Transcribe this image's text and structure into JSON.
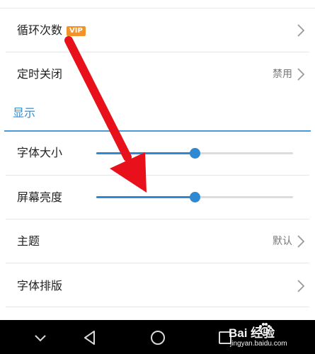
{
  "settings": {
    "loop_count": {
      "label": "循环次数",
      "badge": "VIP"
    },
    "timer_close": {
      "label": "定时关闭",
      "value": "禁用"
    },
    "display_section": "显示",
    "font_size": {
      "label": "字体大小",
      "level": 0.5
    },
    "brightness": {
      "label": "屏幕亮度",
      "level": 0.5
    },
    "theme": {
      "label": "主题",
      "value": "默认"
    },
    "typesetting": {
      "label": "字体排版"
    }
  },
  "watermark": {
    "brand": "Bai 经验",
    "url": "jingyan.baidu.com"
  },
  "colors": {
    "accent": "#2e88d2",
    "vip": "#f0932b",
    "arrow": "#e8101a"
  },
  "icons": {
    "chevron": "chevron-right-icon",
    "nav_down": "chevron-down-icon",
    "nav_back": "back-triangle-icon",
    "nav_home": "home-circle-icon",
    "nav_recent": "recent-square-icon"
  }
}
